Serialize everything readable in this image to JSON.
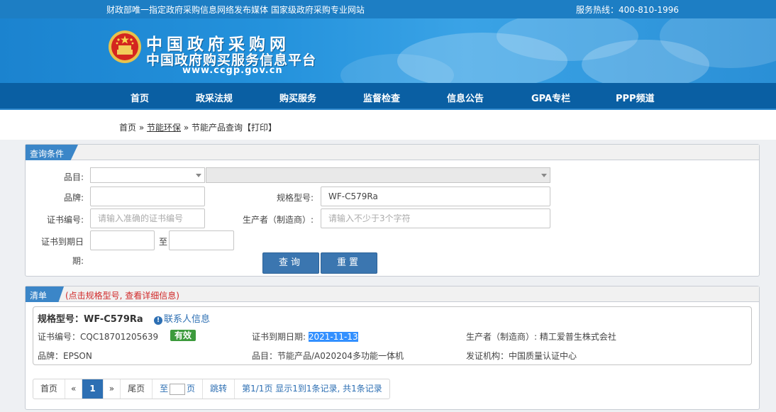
{
  "header": {
    "slogan": "财政部唯一指定政府采购信息网络发布媒体 国家级政府采购专业网站",
    "hotline": "服务热线：400-810-1996",
    "logo_line1": "中国政府采购网",
    "logo_line2": "中国政府购买服务信息平台",
    "logo_url": "www.ccgp.gov.cn"
  },
  "nav": [
    "首页",
    "政采法规",
    "购买服务",
    "监督检查",
    "信息公告",
    "GPA专栏",
    "PPP频道"
  ],
  "breadcrumb": {
    "home": "首页",
    "sep1": " » ",
    "section": "节能环保",
    "sep2": " » ",
    "current": "节能产品查询",
    "print": "【打印】"
  },
  "query_panel": {
    "title": "查询条件",
    "category_label": "品目:",
    "brand_label": "品牌:",
    "brand_value": "",
    "model_label": "规格型号:",
    "model_value": "WF-C579Ra",
    "cert_no_label": "证书编号:",
    "cert_no_placeholder": "请输入准确的证书编号",
    "manufacturer_label": "生产者（制造商）:",
    "manufacturer_placeholder": "请输入不少于3个字符",
    "expiry_label_1": "证书到期日",
    "expiry_label_2": "期:",
    "to_label": "至",
    "search_button": "查询",
    "reset_button": "重置"
  },
  "results_panel": {
    "title": "清单",
    "note": "(点击规格型号, 查看详细信息)",
    "items": [
      {
        "model": "规格型号：WF-C579Ra",
        "contact": "联系人信息",
        "cert_no": "证书编号：CQC18701205639",
        "status": "有效",
        "expiry_label": "证书到期日期: ",
        "expiry_date": "2021-11-13",
        "manufacturer": "生产者（制造商）: 精工爱普生株式会社",
        "brand": "品牌：EPSON",
        "category": "品目：节能产品/A020204多功能一体机",
        "issuer": "发证机构：中国质量认证中心"
      }
    ]
  },
  "pager": {
    "first": "首页",
    "prev": "«",
    "current": "1",
    "next": "»",
    "last": "尾页",
    "goto_prefix": "至",
    "goto_suffix": "页",
    "jump": "跳转",
    "summary": "第1/1页  显示1到1条记录, 共1条记录"
  },
  "colors": {
    "topbar": "#1d7ec4",
    "nav": "#0a5fa3",
    "tab": "#3b86c8",
    "button": "#3b76b0",
    "badge": "#3c9a3c",
    "note": "#d12a2a"
  },
  "icons": [
    "national-emblem-icon",
    "caret-down-icon",
    "info-icon"
  ]
}
